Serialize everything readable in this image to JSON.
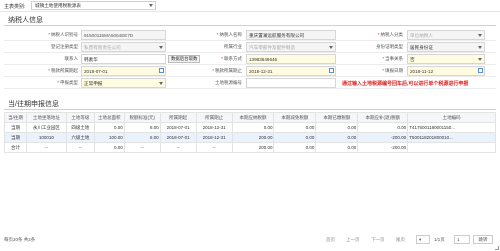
{
  "topbar": {
    "label": "主表类别:",
    "selected": "城镇土地使用税税源表"
  },
  "taxpayer": {
    "title": "纳税人信息",
    "fields": {
      "taxpayer_id": {
        "label": "纳税人识别号",
        "value": "91500115MA5064EE7D"
      },
      "taxpayer_name": {
        "label": "纳税人名称",
        "value": "重庆置澜远航服务有限公司"
      },
      "taxpayer_type": {
        "label": "纳税人分类",
        "value": "单位纳税人"
      },
      "reg_type": {
        "label": "登记注册类型",
        "value": "私营有限责任公司"
      },
      "industry": {
        "label": "所属行业",
        "value": "汽车零部件及配件制造"
      },
      "id_type": {
        "label": "身份证明类型",
        "value": "居民身份证"
      },
      "contact": {
        "label": "联系人",
        "value": "韩素华",
        "check_button": "数据后台取数"
      },
      "phone": {
        "label": "联系方式",
        "value": "13983646646"
      },
      "party": {
        "label": "当事关系",
        "value": "否"
      },
      "period_start": {
        "label": "税款所属期起",
        "value": "2018-07-01"
      },
      "period_end": {
        "label": "税款所属期止",
        "value": "2018-12-31"
      },
      "fill_date": {
        "label": "填报日期",
        "value": "2018-11-12"
      },
      "land_use": {
        "label": "申报类型",
        "value": "正常申报"
      },
      "land_no": {
        "label": "土地税源编号",
        "value": ""
      },
      "notice": "通过输入土地税源编号回车后,可以进行单个税源进行申报"
    }
  },
  "history": {
    "title": "当/往期申报信息",
    "columns": [
      "当/往期",
      "土地坐落地址",
      "土地等级",
      "土地总面积",
      "税额标准(元)",
      "所属期起",
      "所属期止",
      "本期应纳税额",
      "本期减免税额",
      "本期已缴税额",
      "本期应补(退)税额",
      "土地编码"
    ],
    "rows": [
      [
        "当期",
        "永川工业园区",
        "四级土地",
        "0.00",
        "8.00",
        "2018-07-01",
        "2018-12-31",
        "0.00",
        "0.00",
        "0.00",
        "0.00",
        "T4175001180001150..."
      ],
      [
        "当期",
        "100010",
        "六级土地",
        "100.00",
        "6.00",
        "2018-07-01",
        "2018-12-31",
        "200.00",
        "0.00",
        "0.00",
        "-200.00",
        "T500118201800010..."
      ],
      [
        "合计",
        "--",
        "--",
        "0.00",
        "--",
        "--",
        "--",
        "200.00",
        "0.00",
        "0.00",
        "-200.00",
        ""
      ]
    ]
  },
  "pager": {
    "summary": "每页20条  共2条",
    "first": "首页",
    "prev": "上一页",
    "next": "下一页",
    "last": "尾页",
    "page_info": "1/1页",
    "goto": "跳转"
  }
}
